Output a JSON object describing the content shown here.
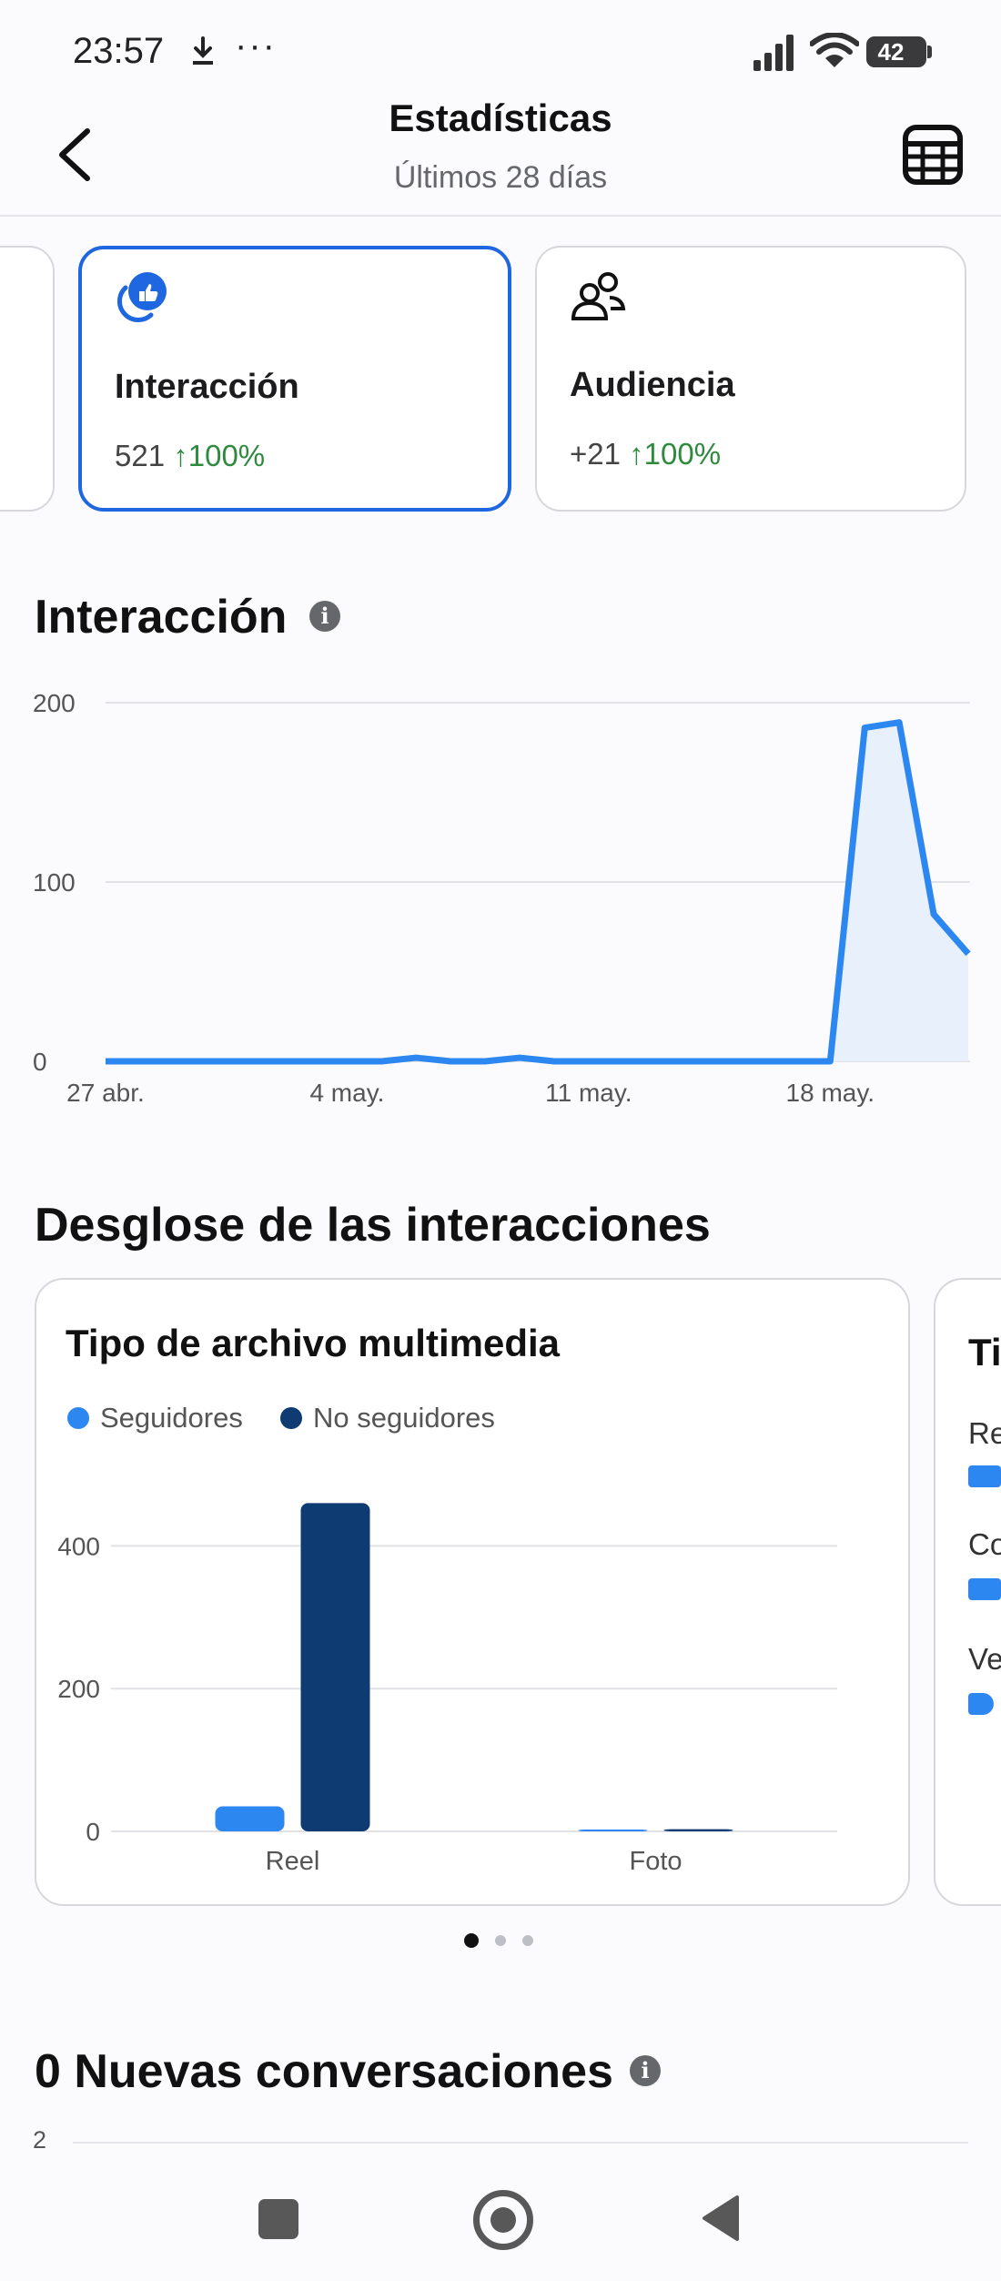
{
  "status_bar": {
    "time": "23:57",
    "more": "···",
    "battery": "42"
  },
  "header": {
    "title": "Estadísticas",
    "subtitle": "Últimos 28 días"
  },
  "metric_cards": [
    {
      "title": "Interacción",
      "value": "521",
      "change": "↑100%"
    },
    {
      "title": "Audiencia",
      "value": "+21",
      "change": "↑100%"
    }
  ],
  "interaction_section": {
    "title": "Interacción",
    "info": "i"
  },
  "breakdown_section": {
    "title": "Desglose de las interacciones",
    "card_title": "Tipo de archivo multimedia",
    "legend": [
      {
        "label": "Seguidores",
        "color": "#2d87f0"
      },
      {
        "label": "No seguidores",
        "color": "#0d3b72"
      }
    ],
    "next_card": {
      "title_fragment": "Ti",
      "rows": [
        "Re",
        "Co",
        "Ve"
      ]
    }
  },
  "conversations_section": {
    "title": "0 Nuevas conversaciones",
    "info": "i",
    "first_tick": "2"
  },
  "chart_data": [
    {
      "type": "area",
      "title": "Interacción",
      "x": [
        "27 abr.",
        "28 abr.",
        "29 abr.",
        "30 abr.",
        "1 may.",
        "2 may.",
        "3 may.",
        "4 may.",
        "5 may.",
        "6 may.",
        "7 may.",
        "8 may.",
        "9 may.",
        "10 may.",
        "11 may.",
        "12 may.",
        "13 may.",
        "14 may.",
        "15 may.",
        "16 may.",
        "17 may.",
        "18 may.",
        "19 may.",
        "20 may.",
        "21 may.",
        "22 may."
      ],
      "x_tick_labels": [
        "27 abr.",
        "4 may.",
        "11 may.",
        "18 may."
      ],
      "series": [
        {
          "values": [
            0,
            0,
            0,
            0,
            0,
            0,
            0,
            0,
            0,
            2,
            0,
            0,
            2,
            0,
            0,
            0,
            0,
            0,
            0,
            0,
            0,
            0,
            186,
            189,
            82,
            60
          ]
        }
      ],
      "ylim": [
        0,
        200
      ],
      "y_ticks": [
        0,
        100,
        200
      ],
      "color": "#2d87f0",
      "grid": true
    },
    {
      "type": "bar",
      "title": "Tipo de archivo multimedia",
      "categories": [
        "Reel",
        "Foto"
      ],
      "series": [
        {
          "name": "Seguidores",
          "values": [
            35,
            1
          ],
          "color": "#2d87f0"
        },
        {
          "name": "No seguidores",
          "values": [
            460,
            3
          ],
          "color": "#0d3b72"
        }
      ],
      "ylim": [
        0,
        500
      ],
      "y_ticks": [
        0,
        200,
        400
      ],
      "grid": true,
      "legend": "top-left"
    }
  ]
}
